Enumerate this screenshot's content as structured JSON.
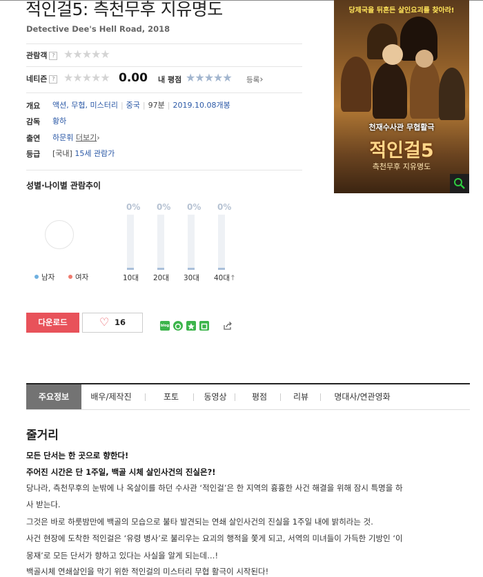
{
  "movie": {
    "title": "적인걸5: 측천무후 지유명도",
    "subtitle": "Detective Dee's Hell Road, 2018"
  },
  "ratings": {
    "audience_label": "관람객",
    "netizen_label": "네티즌",
    "help_glyph": "?",
    "star_glyphs": "★★★★★",
    "netizen_score": "0.00",
    "my_rating_label": "내 평점",
    "register_label": "등록",
    "register_arrow": "›"
  },
  "info": {
    "overview_label": "개요",
    "genres": "액션, 무협, 미스터리",
    "country": "중국",
    "runtime": "97분",
    "release": "2019.10.08개봉",
    "director_label": "감독",
    "director": "황하",
    "cast_label": "출연",
    "cast": "하문휘",
    "cast_more": "더보기",
    "cast_more_arrow": "›",
    "grade_label": "등급",
    "grade_country": "[국내]",
    "grade": "15세 관람가"
  },
  "poster": {
    "tagline": "당제국을 뒤흔든 살인요괴를 찾아라!",
    "mid_text": "천재수사관 무협활극",
    "big_title": "적인걸5",
    "sub_title": "측천무후 지유명도",
    "icon": "magnifier-icon"
  },
  "audience_trend": {
    "heading": "성별·나이별 관람추이",
    "legend_male": "남자",
    "legend_female": "여자",
    "male_color": "#6fb0e0",
    "female_color": "#f07b6e",
    "ages": [
      {
        "label": "10대",
        "pct": "0%",
        "value": 0
      },
      {
        "label": "20대",
        "pct": "0%",
        "value": 0
      },
      {
        "label": "30대",
        "pct": "0%",
        "value": 0
      },
      {
        "label": "40대",
        "pct": "0%",
        "value": 0
      }
    ],
    "age_suffix": "↑"
  },
  "actions": {
    "download_label": "다운로드",
    "like_count": "16",
    "heart_glyph": "♡",
    "blog_label": "blog",
    "share_icon": "share-icon"
  },
  "tabs": [
    {
      "label": "주요정보",
      "active": true
    },
    {
      "label": "배우/제작진",
      "active": false
    },
    {
      "label": "포토",
      "active": false
    },
    {
      "label": "동영상",
      "active": false
    },
    {
      "label": "평점",
      "active": false
    },
    {
      "label": "리뷰",
      "active": false
    },
    {
      "label": "명대사/연관영화",
      "active": false
    }
  ],
  "plot": {
    "heading": "줄거리",
    "lead1": "모든 단서는 한 곳으로 향한다!",
    "lead2": "주어진 시간은 단 1주일, 백골 시체 살인사건의 진실은?!",
    "p1a": "당나라, 측천무후의 눈밖에 나 옥살이를 하던 수사관 ‘적인걸’은 한 지역의 흉흉한 사건 해결을 위해 잠시 특명을 하",
    "p1b": "사 받는다.",
    "p2": " 그것은 바로 하룻밤만에 백골의 모습으로 불타 발견되는 연쇄 살인사건의 진실을 1주일 내에 밝히라는 것.",
    "p3a": " 사건 현장에 도착한 적인걸은 ‘유령 병사’로 불리우는 요괴의 행적을 쫓게 되고, 서역의 미녀들이 가득한 기방인 ‘이",
    "p3b": "몽재’로 모든 단서가 향하고 있다는 사실을 알게 되는데…!",
    "p4": "백골시체 연쇄살인을 막기 위한 적인걸의 미스터리 무협 활극이 시작된다!"
  }
}
